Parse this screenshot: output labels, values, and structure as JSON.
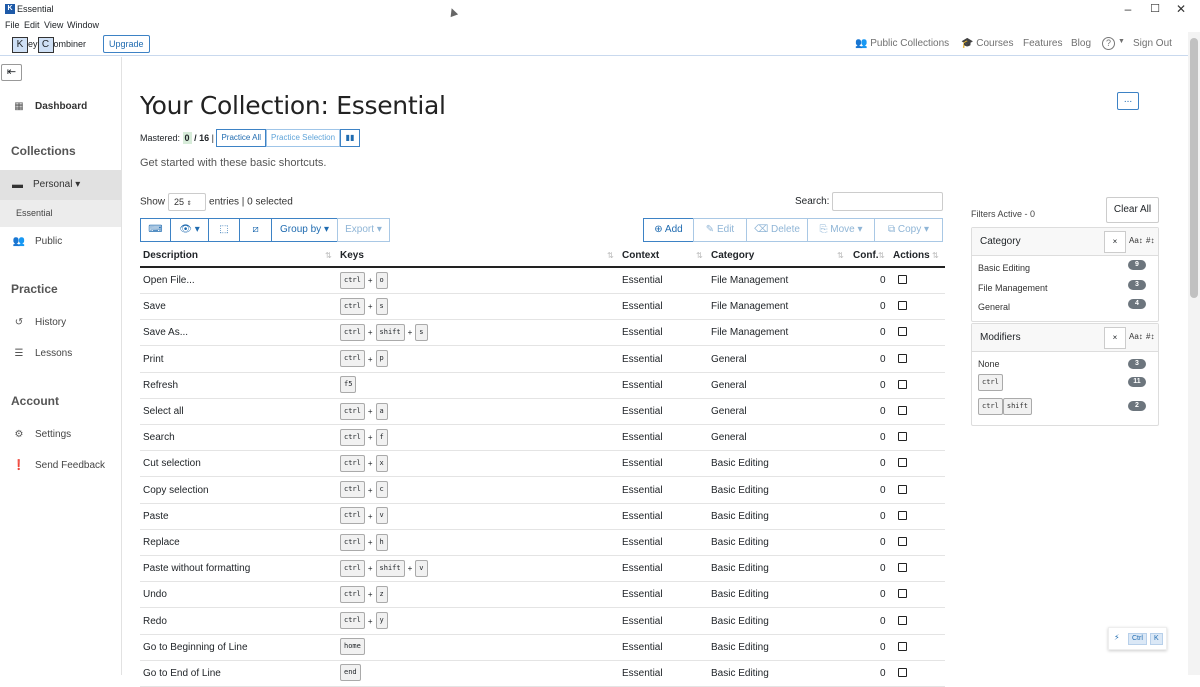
{
  "window": {
    "title": "Essential",
    "app_icon": "K"
  },
  "menu": [
    "File",
    "Edit",
    "View",
    "Window"
  ],
  "topnav": {
    "logo": {
      "k": "K",
      "ey": "ey",
      "c": "C",
      "ombiner": "ombiner"
    },
    "upgrade": "Upgrade",
    "public_collections": "Public Collections",
    "courses": "Courses",
    "features": "Features",
    "blog": "Blog",
    "help": "?",
    "sign_out": "Sign Out"
  },
  "sidebar": {
    "dashboard": "Dashboard",
    "collections_head": "Collections",
    "personal": "Personal ▾",
    "essential": "Essential",
    "public": "Public",
    "practice_head": "Practice",
    "history": "History",
    "lessons": "Lessons",
    "account_head": "Account",
    "settings": "Settings",
    "send_feedback": "Send Feedback"
  },
  "main": {
    "title": "Your Collection: Essential",
    "more": "...",
    "mastered_label": "Mastered:",
    "mastered_count": "0",
    "mastered_total": "/ 16",
    "sep": "|",
    "practice_all": "Practice All",
    "practice_selection": "Practice Selection",
    "subtitle": "Get started with these basic shortcuts.",
    "show": "Show",
    "entries_count": "25",
    "entries_label": "entries | 0 selected",
    "search_label": "Search:",
    "search_value": ""
  },
  "toolbar": {
    "group_by": "Group by ▾",
    "export": "Export ▾",
    "add": "Add",
    "edit": "Edit",
    "delete": "Delete",
    "move": "Move ▾",
    "copy": "Copy ▾"
  },
  "table": {
    "headers": [
      "Description",
      "Keys",
      "Context",
      "Category",
      "Conf.",
      "Actions"
    ],
    "rows": [
      {
        "desc": "Open File...",
        "keys": [
          "ctrl",
          "o"
        ],
        "context": "Essential",
        "category": "File Management",
        "conf": "0"
      },
      {
        "desc": "Save",
        "keys": [
          "ctrl",
          "s"
        ],
        "context": "Essential",
        "category": "File Management",
        "conf": "0"
      },
      {
        "desc": "Save As...",
        "keys": [
          "ctrl",
          "shift",
          "s"
        ],
        "context": "Essential",
        "category": "File Management",
        "conf": "0"
      },
      {
        "desc": "Print",
        "keys": [
          "ctrl",
          "p"
        ],
        "context": "Essential",
        "category": "General",
        "conf": "0"
      },
      {
        "desc": "Refresh",
        "keys": [
          "f5"
        ],
        "context": "Essential",
        "category": "General",
        "conf": "0"
      },
      {
        "desc": "Select all",
        "keys": [
          "ctrl",
          "a"
        ],
        "context": "Essential",
        "category": "General",
        "conf": "0"
      },
      {
        "desc": "Search",
        "keys": [
          "ctrl",
          "f"
        ],
        "context": "Essential",
        "category": "General",
        "conf": "0"
      },
      {
        "desc": "Cut selection",
        "keys": [
          "ctrl",
          "x"
        ],
        "context": "Essential",
        "category": "Basic Editing",
        "conf": "0"
      },
      {
        "desc": "Copy selection",
        "keys": [
          "ctrl",
          "c"
        ],
        "context": "Essential",
        "category": "Basic Editing",
        "conf": "0"
      },
      {
        "desc": "Paste",
        "keys": [
          "ctrl",
          "v"
        ],
        "context": "Essential",
        "category": "Basic Editing",
        "conf": "0"
      },
      {
        "desc": "Replace",
        "keys": [
          "ctrl",
          "h"
        ],
        "context": "Essential",
        "category": "Basic Editing",
        "conf": "0"
      },
      {
        "desc": "Paste without formatting",
        "keys": [
          "ctrl",
          "shift",
          "v"
        ],
        "context": "Essential",
        "category": "Basic Editing",
        "conf": "0"
      },
      {
        "desc": "Undo",
        "keys": [
          "ctrl",
          "z"
        ],
        "context": "Essential",
        "category": "Basic Editing",
        "conf": "0"
      },
      {
        "desc": "Redo",
        "keys": [
          "ctrl",
          "y"
        ],
        "context": "Essential",
        "category": "Basic Editing",
        "conf": "0"
      },
      {
        "desc": "Go to Beginning of Line",
        "keys": [
          "home"
        ],
        "context": "Essential",
        "category": "Basic Editing",
        "conf": "0"
      },
      {
        "desc": "Go to End of Line",
        "keys": [
          "end"
        ],
        "context": "Essential",
        "category": "Basic Editing",
        "conf": "0"
      }
    ]
  },
  "filters": {
    "title": "Filters Active - 0",
    "clear_all": "Clear All",
    "category": {
      "label": "Category",
      "clear": "×",
      "sort_alpha": "Aa↕",
      "sort_count": "#↕",
      "items": [
        {
          "label": "Basic Editing",
          "count": "9"
        },
        {
          "label": "File Management",
          "count": "3"
        },
        {
          "label": "General",
          "count": "4"
        }
      ]
    },
    "modifiers": {
      "label": "Modifiers",
      "clear": "×",
      "sort_alpha": "Aa↕",
      "sort_count": "#↕",
      "none": "None",
      "none_count": "3",
      "ctrl": "ctrl",
      "ctrl_count": "11",
      "shift": "shift",
      "ctrl_shift_count": "2"
    }
  },
  "kb_widget": {
    "ctrl": "Ctrl",
    "k": "K"
  }
}
